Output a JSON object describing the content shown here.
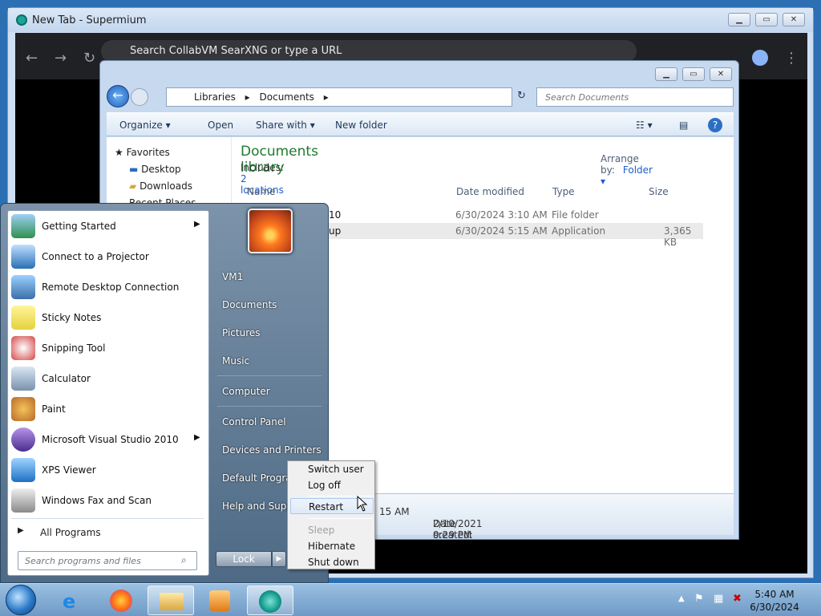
{
  "browser": {
    "window_title": "New Tab - Supermium",
    "omnibox_placeholder": "Search CollabVM SearXNG or type a URL"
  },
  "explorer": {
    "breadcrumb": [
      "Libraries",
      "Documents"
    ],
    "search_placeholder": "Search Documents",
    "toolbar": {
      "organize": "Organize",
      "open": "Open",
      "share_with": "Share with",
      "new_folder": "New folder"
    },
    "nav": {
      "favorites": "Favorites",
      "desktop": "Desktop",
      "downloads": "Downloads",
      "recent_places": "Recent Places"
    },
    "library_title": "Documents library",
    "includes_label": "Includes:",
    "includes_link": "2 locations",
    "arrange_label": "Arrange by:",
    "arrange_value": "Folder",
    "columns": [
      "Name",
      "Date modified",
      "Type",
      "Size"
    ],
    "rows": [
      {
        "name": "10",
        "date": "6/30/2024 3:10 AM",
        "type": "File folder",
        "size": ""
      },
      {
        "name": "up",
        "date": "6/30/2024 5:15 AM",
        "type": "Application",
        "size": "3,365 KB"
      }
    ],
    "details": {
      "modified_partial": "15 AM",
      "date_created_label": "Date created:",
      "date_created": "2/10/2021 9:29 PM"
    }
  },
  "start_menu": {
    "programs": [
      {
        "label": "Getting Started",
        "icon": "getting-started-icon",
        "submenu": true
      },
      {
        "label": "Connect to a Projector",
        "icon": "projector-icon",
        "submenu": false
      },
      {
        "label": "Remote Desktop Connection",
        "icon": "remote-desktop-icon",
        "submenu": false
      },
      {
        "label": "Sticky Notes",
        "icon": "sticky-notes-icon",
        "submenu": false
      },
      {
        "label": "Snipping Tool",
        "icon": "snipping-tool-icon",
        "submenu": false
      },
      {
        "label": "Calculator",
        "icon": "calculator-icon",
        "submenu": false
      },
      {
        "label": "Paint",
        "icon": "paint-icon",
        "submenu": false
      },
      {
        "label": "Microsoft Visual Studio 2010",
        "icon": "visual-studio-icon",
        "submenu": true
      },
      {
        "label": "XPS Viewer",
        "icon": "xps-viewer-icon",
        "submenu": false
      },
      {
        "label": "Windows Fax and Scan",
        "icon": "fax-scan-icon",
        "submenu": false
      }
    ],
    "all_programs": "All Programs",
    "search_placeholder": "Search programs and files",
    "right_links": [
      "VM1",
      "Documents",
      "Pictures",
      "Music",
      "Computer",
      "Control Panel",
      "Devices and Printers",
      "Default Programs",
      "Help and Support"
    ],
    "lock_label": "Lock"
  },
  "shutdown_menu": {
    "items": [
      "Switch user",
      "Log off",
      "Restart",
      "Sleep",
      "Hibernate",
      "Shut down"
    ],
    "highlighted": "Restart",
    "disabled": [
      "Sleep"
    ]
  },
  "taskbar": {
    "time": "5:40 AM",
    "date": "6/30/2024"
  }
}
